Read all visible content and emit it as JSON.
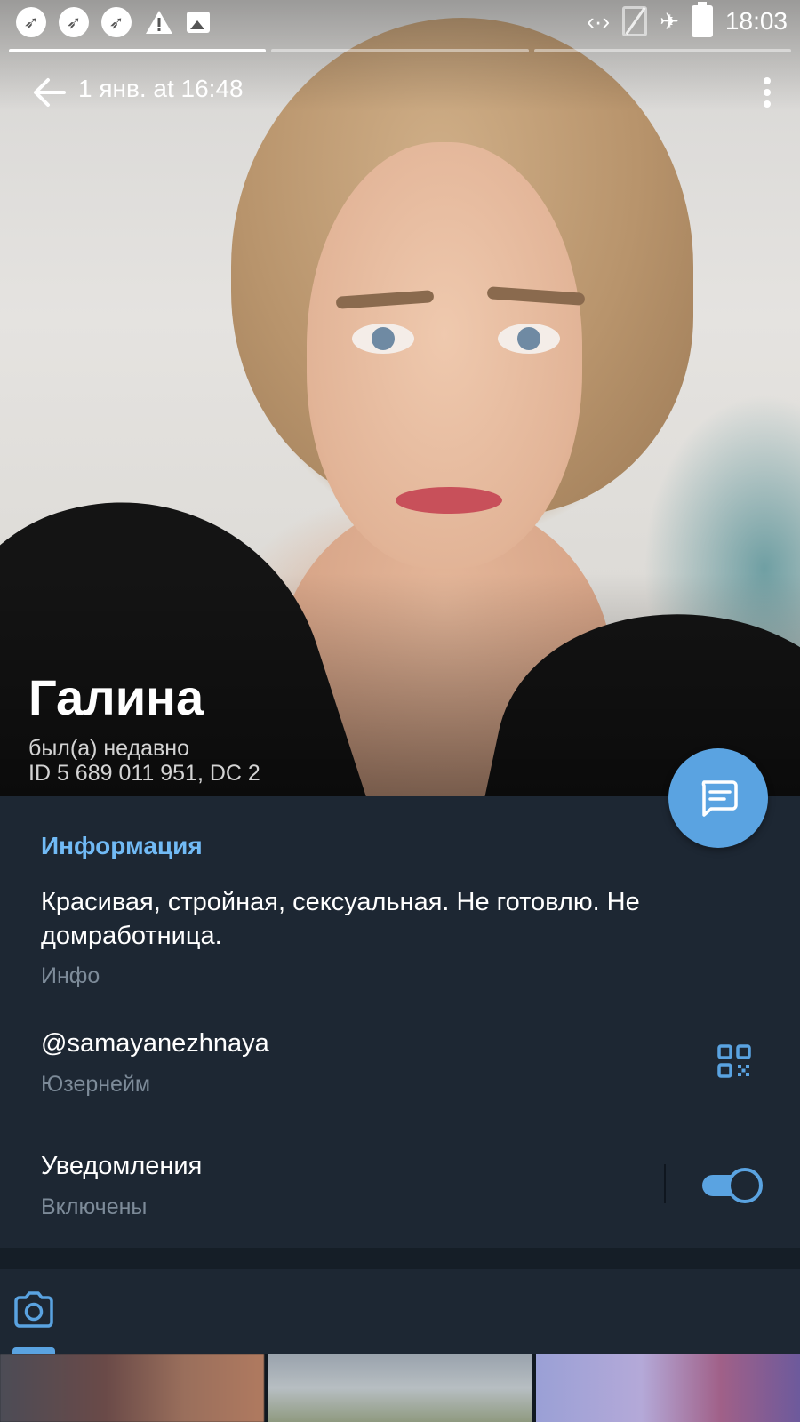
{
  "status_bar": {
    "left_icons": [
      "app-notification-icon",
      "app-notification-icon",
      "app-notification-icon",
      "warning-icon",
      "image-icon"
    ],
    "right_icons": [
      "data-transfer-icon",
      "no-sim-icon",
      "airplane-mode-icon",
      "battery-charging-icon"
    ],
    "time": "18:03"
  },
  "story_progress": {
    "segments": 3,
    "active_index": 0
  },
  "top_bar": {
    "back_icon": "arrow-left-icon",
    "date": "1 янв. at 16:48",
    "menu_icon": "more-vertical-icon"
  },
  "profile": {
    "name": "Галина",
    "last_seen": "был(а) недавно",
    "id_line": "ID 5 689 011 951, DC 2"
  },
  "fab": {
    "icon": "message-icon"
  },
  "info": {
    "section_title": "Информация",
    "bio": "Красивая, стройная, сексуальная. Не готовлю. Не домработница.",
    "bio_label": "Инфо",
    "username": "@samayanezhnaya",
    "username_label": "Юзернейм",
    "qr_icon": "qr-code-icon",
    "notifications_title": "Уведомления",
    "notifications_status": "Включены",
    "notifications_enabled": true
  },
  "media": {
    "tab_icon": "camera-icon",
    "thumbnails": 3
  },
  "colors": {
    "background": "#1d2733",
    "accent": "#5aa3e1",
    "section_title": "#71baf5",
    "secondary_text": "#7d8b99"
  }
}
